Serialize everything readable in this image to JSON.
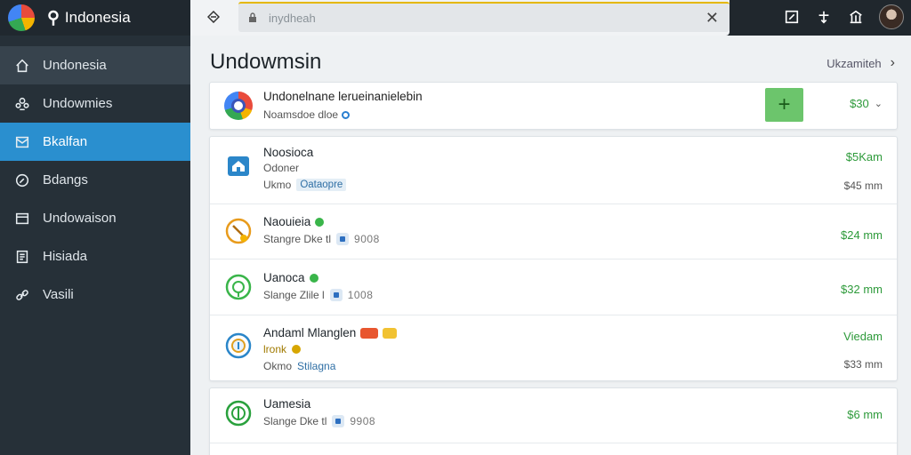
{
  "sidebar": {
    "brand": "Indonesia",
    "items": [
      {
        "label": "Undonesia",
        "icon": "home-icon"
      },
      {
        "label": "Undowmies",
        "icon": "users-icon"
      },
      {
        "label": "Bkalfan",
        "icon": "inbox-icon"
      },
      {
        "label": "Bdangs",
        "icon": "compass-icon"
      },
      {
        "label": "Undowaison",
        "icon": "card-icon"
      },
      {
        "label": "Hisiada",
        "icon": "document-icon"
      },
      {
        "label": "Vasili",
        "icon": "link-icon"
      }
    ],
    "active_index": 2
  },
  "topbar": {
    "address_text": "inydheah",
    "icons": [
      "screen-icon",
      "share-icon",
      "bank-icon",
      "avatar"
    ]
  },
  "main": {
    "title": "Undowmsin",
    "breadcrumb": "Ukzamiteh",
    "summary": {
      "title": "Undonelnane lerueinanielebin",
      "subtitle": "Noamsdoe dloe",
      "price": "$30"
    },
    "rows": [
      {
        "title": "Noosioca",
        "sub1": "Odoner",
        "sub2_prefix": "Ukmo",
        "sub2_tag": "Oataopre",
        "right1": "$5Kam",
        "right2": "$45 mm",
        "icon": "house-icon"
      },
      {
        "title": "Naouieia",
        "sub1_prefix": "Stangre Dke tl",
        "number": "9008",
        "right1": "$24 mm",
        "icon": "wrench-icon"
      },
      {
        "title": "Uanoca",
        "sub1_prefix": "Slange Zlile l",
        "number": "1008",
        "right1": "$32 mm",
        "icon": "leaf-icon"
      },
      {
        "title": "Andaml Mlanglen",
        "sub1": "lronk",
        "sub2_prefix": "Okmo",
        "sub2_tag": "Stilagna",
        "right1": "Viedam",
        "right2": "$33 mm",
        "icon": "info-icon"
      },
      {
        "title": "Uamesia",
        "sub1_prefix": "Slange Dke tl",
        "number": "9908",
        "right1": "$6 mm",
        "icon": "globe-icon"
      }
    ]
  }
}
